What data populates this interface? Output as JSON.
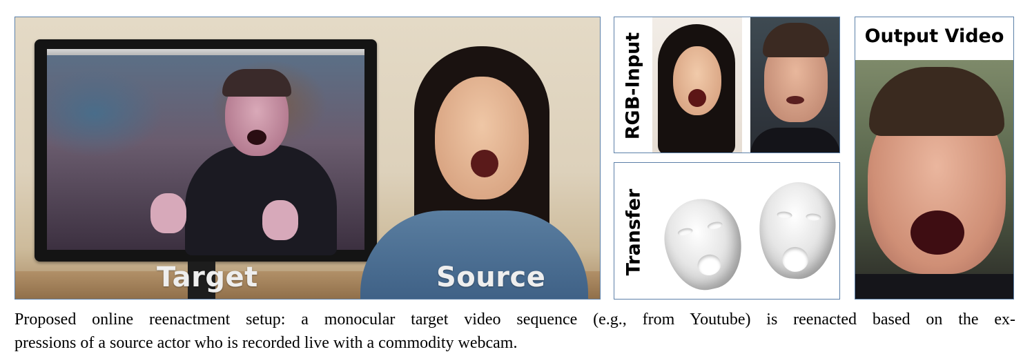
{
  "figure": {
    "main_photo": {
      "target_label": "Target",
      "source_label": "Source"
    },
    "rgb_input_panel": {
      "label": "RGB-Input"
    },
    "transfer_panel": {
      "label": "Transfer"
    },
    "output_panel": {
      "label": "Output Video"
    },
    "caption": {
      "line1": "Proposed online reenactment setup: a monocular target video sequence (e.g., from Youtube) is reenacted based on the ex-",
      "line2": "pressions of a source actor who is recorded live with a commodity webcam."
    }
  }
}
